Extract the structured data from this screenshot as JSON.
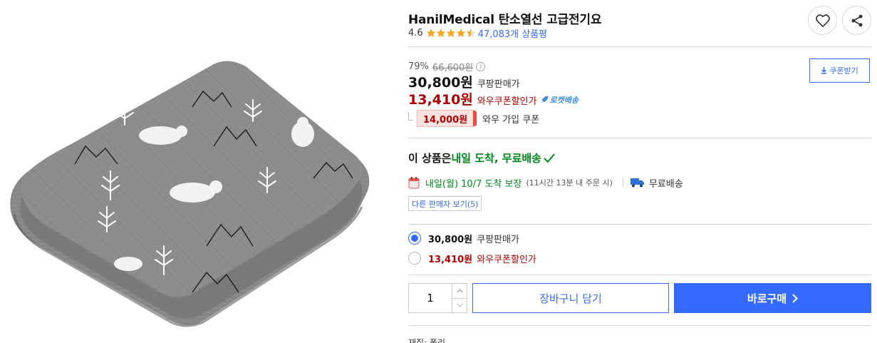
{
  "product": {
    "title": "HanilMedical 탄소열선 고급전기요",
    "rating": "4.6",
    "stars": 4.5,
    "review_count": "47,083개 상품평"
  },
  "actions": {
    "like_icon": "heart-icon",
    "share_icon": "share-icon"
  },
  "price": {
    "discount_rate": "79%",
    "original_price": "66,600원",
    "info_icon": "ⓘ",
    "sale_price": "30,800원",
    "sale_label": "쿠팡판매가",
    "wow_price": "13,410원",
    "wow_label": "와우쿠폰할인가",
    "rocket_badge": "로켓배송",
    "coupon_amount": "14,000원",
    "coupon_label": "와우 가입 쿠폰",
    "coupon_download": "쿠폰받기"
  },
  "delivery": {
    "title_prefix": "이 상품은 ",
    "title_highlight": "내일 도착, 무료배송",
    "eta": "내일(월) 10/7 도착 보장",
    "eta_condition": "(11시간 13분 내 주문 시)",
    "free_shipping": "무료배송",
    "other_sellers": "다른 판매자 보기(5)"
  },
  "options": [
    {
      "price": "30,800원",
      "label": "쿠팡판매가",
      "selected": true
    },
    {
      "price": "13,410원",
      "label": "와우쿠폰할인가",
      "selected": false
    }
  ],
  "purchase": {
    "quantity": "1",
    "cart_label": "장바구니 담기",
    "buy_label": "바로구매"
  },
  "cutoff_text": "재질: 폴리",
  "colors": {
    "accent": "#346aff",
    "price_red": "#ae0000",
    "delivery_green": "#00891a",
    "star": "#f5a623"
  }
}
